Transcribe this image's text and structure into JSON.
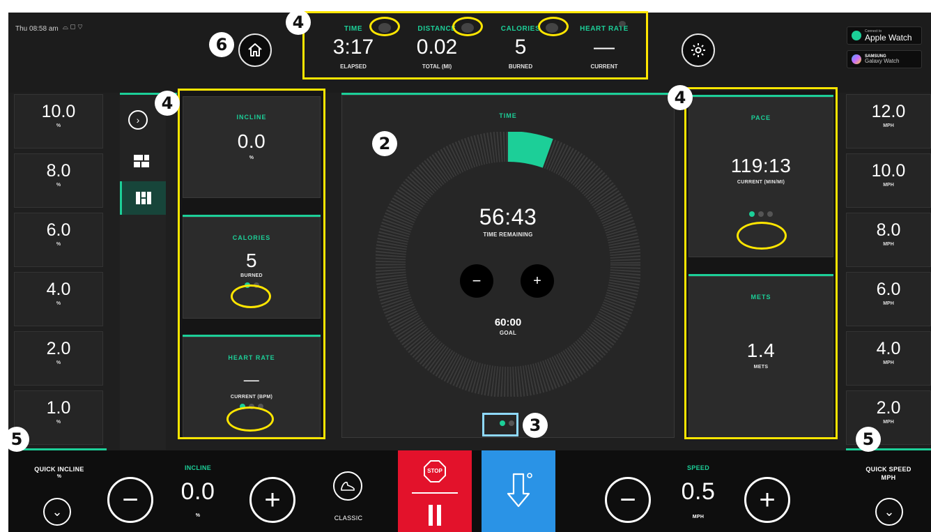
{
  "status_bar": {
    "time": "Thu 08:58 am"
  },
  "top_stats": [
    {
      "label": "TIME",
      "value": "3:17",
      "sub": "ELAPSED"
    },
    {
      "label": "DISTANCE",
      "value": "0.02",
      "sub": "TOTAL (MI)"
    },
    {
      "label": "CALORIES",
      "value": "5",
      "sub": "BURNED"
    },
    {
      "label": "HEART RATE",
      "value": "—",
      "sub": "CURRENT"
    }
  ],
  "watches": {
    "apple_small": "Connect to",
    "apple": "Apple Watch",
    "samsung_top": "SAMSUNG",
    "samsung": "Galaxy Watch"
  },
  "quick_incline": {
    "values": [
      "10.0",
      "8.0",
      "6.0",
      "4.0",
      "2.0",
      "1.0"
    ],
    "unit": "%",
    "label": "QUICK INCLINE",
    "unit_label": "%"
  },
  "quick_speed": {
    "values": [
      "12.0",
      "10.0",
      "8.0",
      "6.0",
      "4.0",
      "2.0"
    ],
    "unit": "MPH",
    "label": "QUICK SPEED",
    "unit_label": "MPH"
  },
  "left_panels": {
    "incline": {
      "title": "INCLINE",
      "value": "0.0",
      "unit": "%"
    },
    "calories": {
      "title": "CALORIES",
      "value": "5",
      "unit": "BURNED"
    },
    "heart_rate": {
      "title": "HEART RATE",
      "value": "—",
      "unit": "CURRENT (BPM)"
    }
  },
  "center": {
    "title": "TIME",
    "remaining": "56:43",
    "remaining_label": "TIME REMAINING",
    "goal": "60:00",
    "goal_label": "GOAL",
    "progress": 0.055
  },
  "right_panels": {
    "pace": {
      "title": "PACE",
      "value": "119:13",
      "unit": "CURRENT (MIN/MI)"
    },
    "mets": {
      "title": "METS",
      "value": "1.4",
      "unit": "METS"
    }
  },
  "bottom": {
    "incline_label": "INCLINE",
    "incline_value": "0.0",
    "incline_unit": "%",
    "mode_label": "CLASSIC",
    "stop_label": "STOP",
    "speed_label": "SPEED",
    "speed_value": "0.5",
    "speed_unit": "MPH"
  },
  "annotations": [
    "4",
    "6",
    "4",
    "2",
    "4",
    "3",
    "5",
    "5"
  ],
  "colors": {
    "accent": "#1ccf98",
    "stop_red": "#e3122b",
    "cooldown_blue": "#2a93e6",
    "highlight": "#ffe600"
  }
}
